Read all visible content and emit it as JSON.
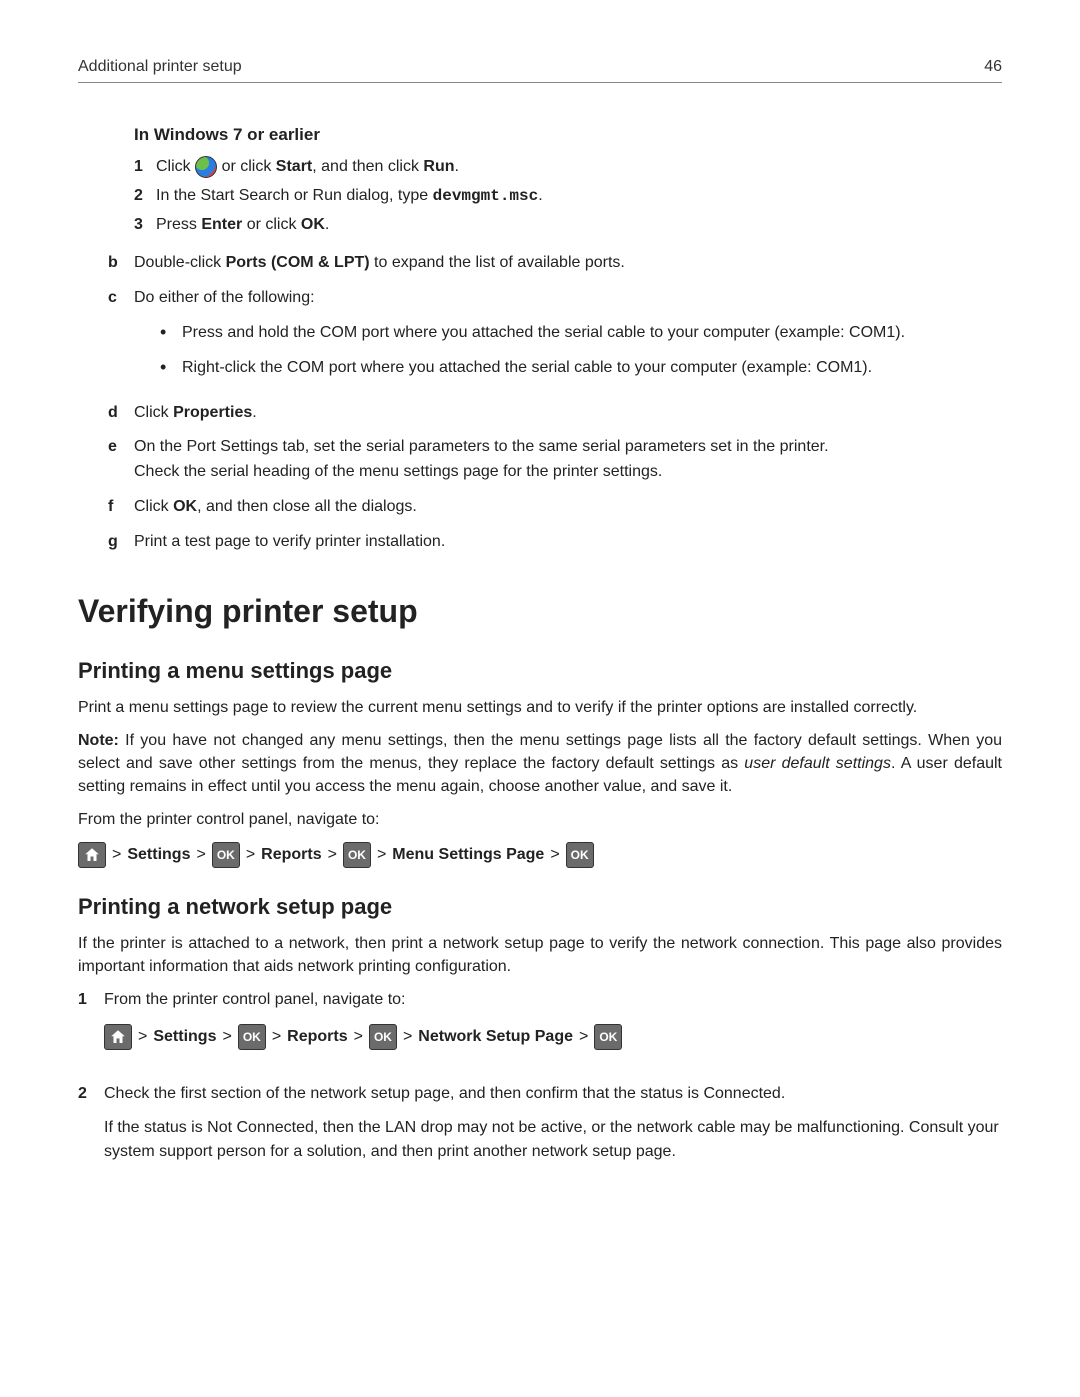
{
  "header": {
    "title": "Additional printer setup",
    "page": "46"
  },
  "win7": {
    "heading": "In Windows 7 or earlier",
    "s1": {
      "n": "1",
      "pre": "Click ",
      "mid": " or click ",
      "start": "Start",
      "mid2": ", and then click ",
      "run": "Run",
      "post": "."
    },
    "s2": {
      "n": "2",
      "pre": "In the Start Search or Run dialog, type ",
      "cmd": "devmgmt.msc",
      "post": "."
    },
    "s3": {
      "n": "3",
      "pre": "Press ",
      "enter": "Enter",
      "mid": " or click ",
      "ok": "OK",
      "post": "."
    }
  },
  "alpha": {
    "b": {
      "m": "b",
      "pre": "Double-click ",
      "bold": "Ports (COM & LPT)",
      "post": " to expand the list of available ports."
    },
    "c": {
      "m": "c",
      "text": "Do either of the following:",
      "bul1": "Press and hold the COM port where you attached the serial cable to your computer (example: COM1).",
      "bul2": "Right-click the COM port where you attached the serial cable to your computer (example: COM1)."
    },
    "d": {
      "m": "d",
      "pre": "Click ",
      "bold": "Properties",
      "post": "."
    },
    "e": {
      "m": "e",
      "l1": "On the Port Settings tab, set the serial parameters to the same serial parameters set in the printer.",
      "l2": "Check the serial heading of the menu settings page for the printer settings."
    },
    "f": {
      "m": "f",
      "pre": "Click ",
      "bold": "OK",
      "post": ", and then close all the dialogs."
    },
    "g": {
      "m": "g",
      "text": "Print a test page to verify printer installation."
    }
  },
  "h1": "Verifying printer setup",
  "menu": {
    "h2": "Printing a menu settings page",
    "p1": "Print a menu settings page to review the current menu settings and to verify if the printer options are installed correctly.",
    "noteLabel": "Note:",
    "noteBody1": " If you have not changed any menu settings, then the menu settings page lists all the factory default settings. When you select and save other settings from the menus, they replace the factory default settings as ",
    "noteItalic": "user default settings",
    "noteBody2": ". A user default setting remains in effect until you access the menu again, choose another value, and save it.",
    "lead": "From the printer control panel, navigate to:",
    "path": {
      "sep": ">",
      "settings": "Settings",
      "reports": "Reports",
      "msp": "Menu Settings Page"
    }
  },
  "net": {
    "h2": "Printing a network setup page",
    "p1": "If the printer is attached to a network, then print a network setup page to verify the network connection. This page also provides important information that aids network printing configuration.",
    "s1": {
      "n": "1",
      "text": "From the printer control panel, navigate to:"
    },
    "path": {
      "sep": ">",
      "settings": "Settings",
      "reports": "Reports",
      "nsp": "Network Setup Page"
    },
    "s2": {
      "n": "2",
      "l1": "Check the first section of the network setup page, and then confirm that the status is Connected.",
      "l2": "If the status is Not Connected, then the LAN drop may not be active, or the network cable may be malfunctioning. Consult your system support person for a solution, and then print another network setup page."
    }
  },
  "icons": {
    "home": "home-icon",
    "ok": "OK",
    "start": "windows-start-icon"
  }
}
